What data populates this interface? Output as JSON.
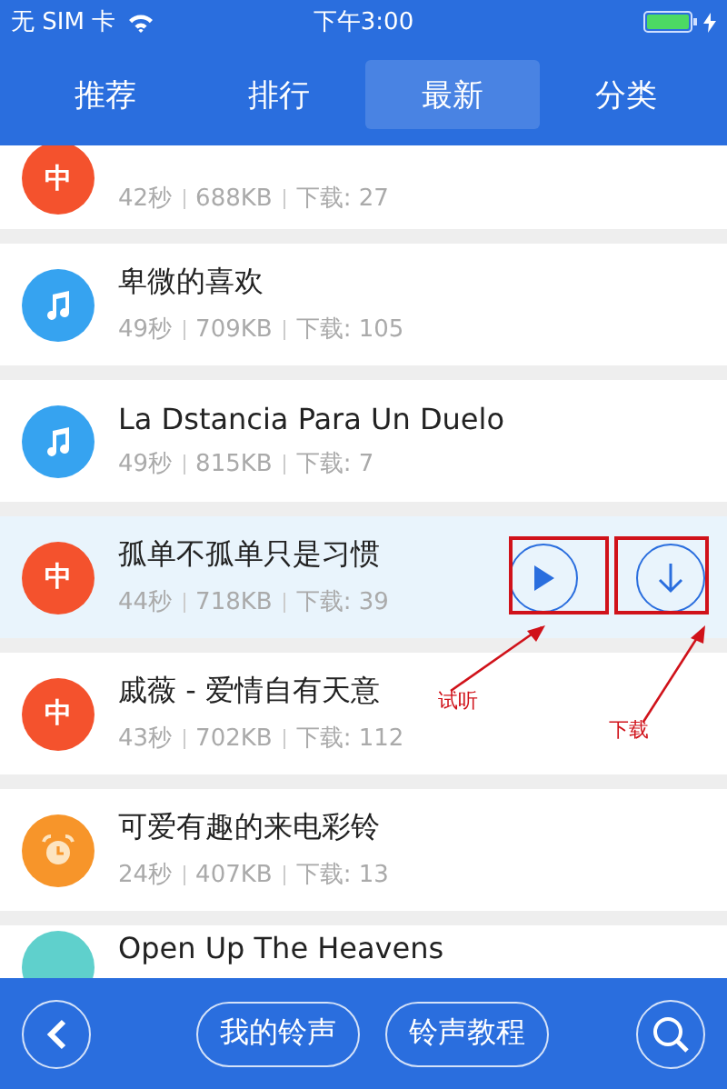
{
  "status_bar": {
    "carrier": "无 SIM 卡",
    "time": "下午3:00",
    "charging": true
  },
  "tabs": [
    {
      "label": "推荐",
      "selected": false
    },
    {
      "label": "排行",
      "selected": false
    },
    {
      "label": "最新",
      "selected": true
    },
    {
      "label": "分类",
      "selected": false
    }
  ],
  "ringtones": [
    {
      "kind": "zhong",
      "badge": "中",
      "color": "#f4522d",
      "duration": "42秒",
      "size": "688KB",
      "downloads": "下载: 27",
      "selected": false
    },
    {
      "kind": "music",
      "color": "#36a3f0",
      "title": "卑微的喜欢",
      "duration": "49秒",
      "size": "709KB",
      "downloads": "下载: 105",
      "selected": false
    },
    {
      "kind": "music",
      "color": "#36a3f0",
      "title": "La Dstancia Para Un Duelo",
      "duration": "49秒",
      "size": "815KB",
      "downloads": "下载: 7",
      "selected": false
    },
    {
      "kind": "zhong",
      "badge": "中",
      "color": "#f4522d",
      "title": "孤单不孤单只是习惯",
      "duration": "44秒",
      "size": "718KB",
      "downloads": "下载: 39",
      "selected": true
    },
    {
      "kind": "zhong",
      "badge": "中",
      "color": "#f4522d",
      "title": "戚薇 - 爱情自有天意",
      "duration": "43秒",
      "size": "702KB",
      "downloads": "下载: 112",
      "selected": false
    },
    {
      "kind": "alarm",
      "color": "#f7952a",
      "title": "可爱有趣的来电彩铃",
      "duration": "24秒",
      "size": "407KB",
      "downloads": "下载: 13",
      "selected": false
    },
    {
      "kind": "plain",
      "color": "#5fd0cc",
      "title": "Open Up The Heavens",
      "selected": false
    }
  ],
  "annotations": [
    {
      "label": "试听"
    },
    {
      "label": "下载"
    }
  ],
  "bottom_bar": {
    "buttons": [
      "我的铃声",
      "铃声教程"
    ]
  }
}
